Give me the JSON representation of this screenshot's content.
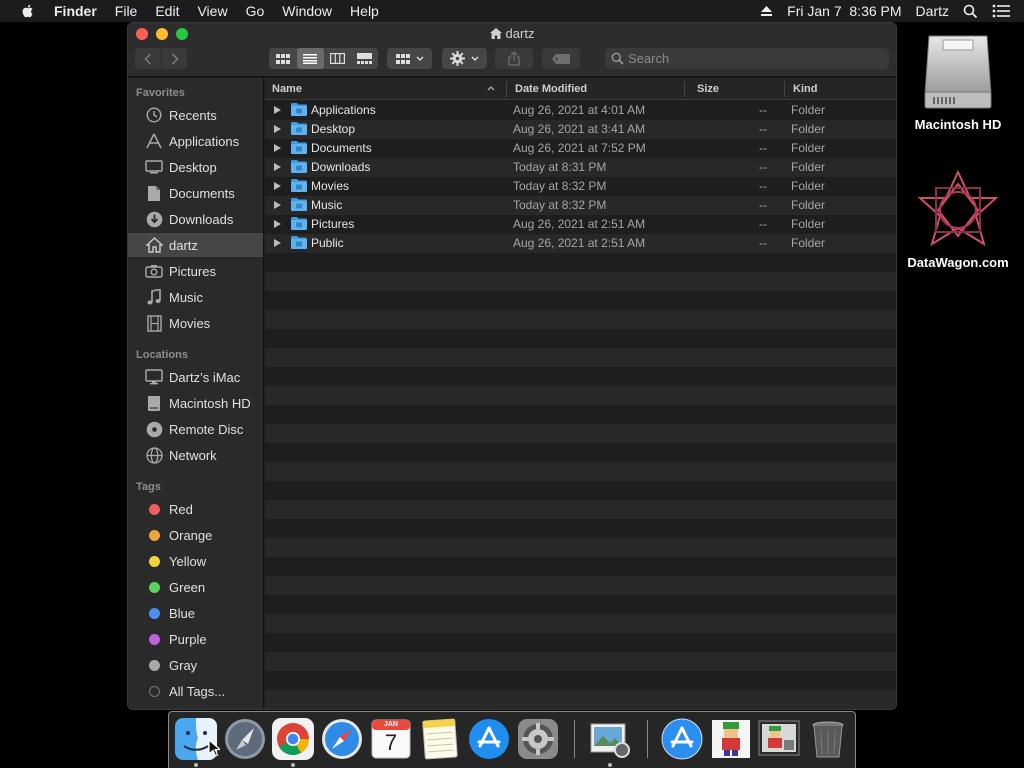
{
  "menubar": {
    "app_name": "Finder",
    "items": [
      "File",
      "Edit",
      "View",
      "Go",
      "Window",
      "Help"
    ],
    "clock": "Fri Jan 7  8:36 PM",
    "user": "Dartz"
  },
  "desktop": {
    "icons": [
      {
        "label": "Macintosh HD",
        "icon": "hard-drive-icon"
      },
      {
        "label": "DataWagon.com",
        "icon": "datawagon-logo-icon"
      }
    ]
  },
  "window": {
    "title": "dartz",
    "search_placeholder": "Search",
    "view_mode": "list"
  },
  "sidebar": {
    "favorites_header": "Favorites",
    "favorites": [
      {
        "label": "Recents",
        "icon": "clock-icon"
      },
      {
        "label": "Applications",
        "icon": "applications-icon"
      },
      {
        "label": "Desktop",
        "icon": "desktop-icon"
      },
      {
        "label": "Documents",
        "icon": "document-icon"
      },
      {
        "label": "Downloads",
        "icon": "download-icon"
      },
      {
        "label": "dartz",
        "icon": "home-icon",
        "selected": true
      },
      {
        "label": "Pictures",
        "icon": "camera-icon"
      },
      {
        "label": "Music",
        "icon": "music-note-icon"
      },
      {
        "label": "Movies",
        "icon": "film-icon"
      }
    ],
    "locations_header": "Locations",
    "locations": [
      {
        "label": "Dartz’s iMac",
        "icon": "imac-icon"
      },
      {
        "label": "Macintosh HD",
        "icon": "hard-drive-icon"
      },
      {
        "label": "Remote Disc",
        "icon": "disc-icon"
      },
      {
        "label": "Network",
        "icon": "globe-icon"
      }
    ],
    "tags_header": "Tags",
    "tags": [
      {
        "label": "Red",
        "color": "#ec5f5f"
      },
      {
        "label": "Orange",
        "color": "#f0a33a"
      },
      {
        "label": "Yellow",
        "color": "#f4d23c"
      },
      {
        "label": "Green",
        "color": "#5ad35a"
      },
      {
        "label": "Blue",
        "color": "#4a90ee"
      },
      {
        "label": "Purple",
        "color": "#c061e0"
      },
      {
        "label": "Gray",
        "color": "#a8a8a8"
      },
      {
        "label": "All Tags...",
        "color": "#555555",
        "all": true
      }
    ]
  },
  "list": {
    "columns": {
      "name": "Name",
      "date": "Date Modified",
      "size": "Size",
      "kind": "Kind"
    },
    "sort_column": "Name",
    "rows": [
      {
        "name": "Applications",
        "date": "Aug 26, 2021 at 4:01 AM",
        "size": "--",
        "kind": "Folder"
      },
      {
        "name": "Desktop",
        "date": "Aug 26, 2021 at 3:41 AM",
        "size": "--",
        "kind": "Folder"
      },
      {
        "name": "Documents",
        "date": "Aug 26, 2021 at 7:52 PM",
        "size": "--",
        "kind": "Folder"
      },
      {
        "name": "Downloads",
        "date": "Today at 8:31 PM",
        "size": "--",
        "kind": "Folder"
      },
      {
        "name": "Movies",
        "date": "Today at 8:32 PM",
        "size": "--",
        "kind": "Folder"
      },
      {
        "name": "Music",
        "date": "Today at 8:32 PM",
        "size": "--",
        "kind": "Folder"
      },
      {
        "name": "Pictures",
        "date": "Aug 26, 2021 at 2:51 AM",
        "size": "--",
        "kind": "Folder"
      },
      {
        "name": "Public",
        "date": "Aug 26, 2021 at 2:51 AM",
        "size": "--",
        "kind": "Folder"
      }
    ]
  },
  "dock": {
    "apps": [
      {
        "icon": "finder-icon",
        "running": true
      },
      {
        "icon": "launchpad-icon",
        "running": false
      },
      {
        "icon": "chrome-icon",
        "running": true
      },
      {
        "icon": "safari-icon",
        "running": false
      },
      {
        "icon": "calendar-icon",
        "running": false,
        "month": "JAN",
        "day": "7"
      },
      {
        "icon": "notes-icon",
        "running": false
      },
      {
        "icon": "app-store-icon",
        "running": false
      },
      {
        "icon": "system-preferences-icon",
        "running": false
      },
      {
        "icon": "preview-icon",
        "running": true
      },
      {
        "icon": "app-store-folder-icon",
        "running": false
      },
      {
        "icon": "game-character-icon",
        "running": false
      },
      {
        "icon": "game-screen-icon",
        "running": false
      },
      {
        "icon": "trash-icon",
        "running": false
      }
    ]
  }
}
